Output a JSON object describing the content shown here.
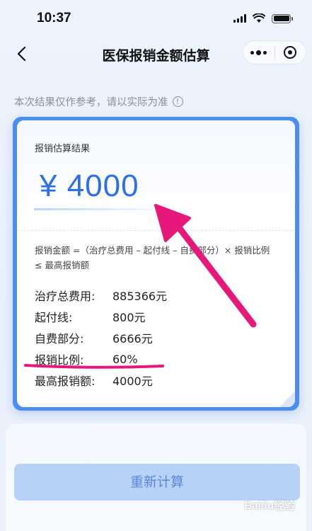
{
  "status_bar": {
    "time": "10:37"
  },
  "nav": {
    "title": "医保报销金额估算",
    "more_label": "更多",
    "close_label": "关闭"
  },
  "notice": {
    "text": "本次结果仅作参考，请以实际为准",
    "info_symbol": "!"
  },
  "result": {
    "label": "报销估算结果",
    "amount": "¥ 4000",
    "formula": "报销金额 =（治疗总费用 – 起付线 – 自费部分）× 报销比例 ≤ 最高报销额"
  },
  "details": [
    {
      "key": "治疗总费用:",
      "value": "885366元"
    },
    {
      "key": "起付线:",
      "value": "800元"
    },
    {
      "key": "自费部分:",
      "value": "6666元"
    },
    {
      "key": "报销比例:",
      "value": "60%"
    },
    {
      "key": "最高报销额:",
      "value": "4000元"
    }
  ],
  "actions": {
    "recalculate_label": "重新计算"
  },
  "watermark": "Baidu经验",
  "colors": {
    "accent": "#2c6fe6",
    "card_border": "#4a8ef0",
    "button_bg": "#b8d2f7",
    "annotation": "#e6187a"
  }
}
